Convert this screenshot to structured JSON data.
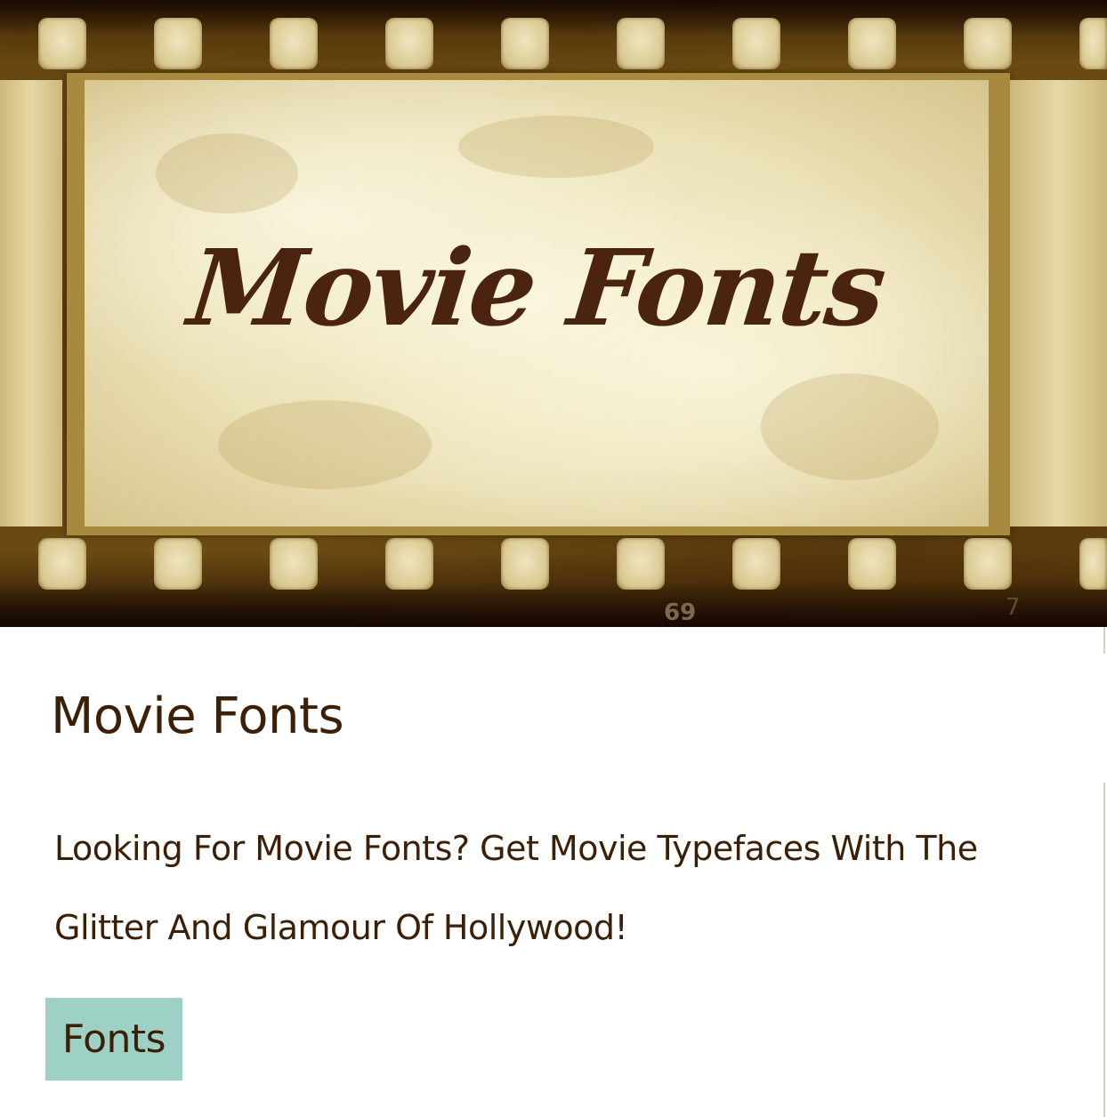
{
  "hero": {
    "title": "Movie Fonts",
    "frame_number": "69",
    "frame_mark": "7"
  },
  "content": {
    "title": "Movie Fonts",
    "description": "Looking For Movie Fonts? Get Movie Typefaces With The Glitter And Glamour Of Hollywood!"
  },
  "tag": {
    "label": "Fonts"
  },
  "colors": {
    "text": "#3b2007",
    "tag_background": "#9ed1c6",
    "hero_title": "#4a2410"
  }
}
